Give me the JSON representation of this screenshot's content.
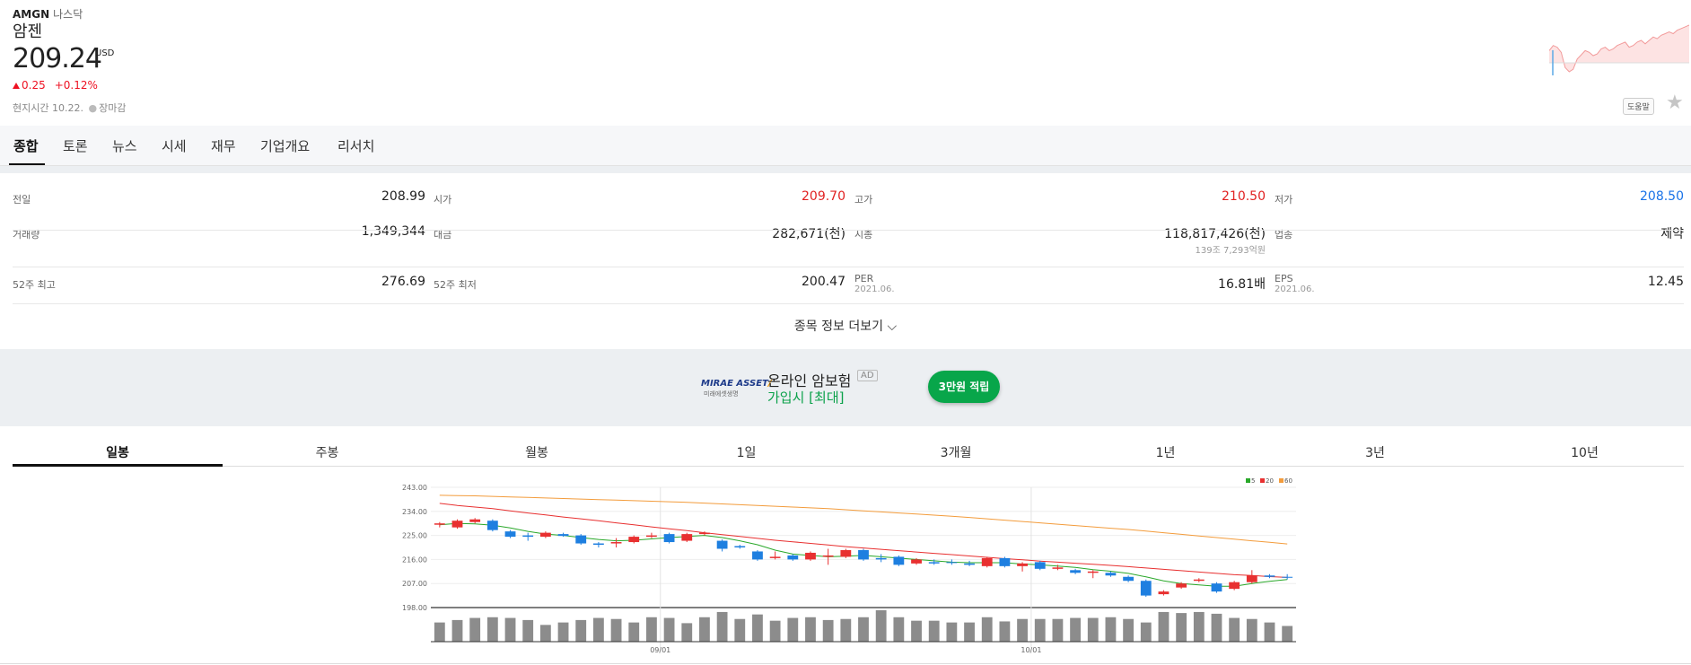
{
  "header": {
    "ticker": "AMGN",
    "market": "나스닥",
    "name": "암젠",
    "price": "209.24",
    "currency": "USD",
    "change": "0.25",
    "change_pct": "+0.12%",
    "local_time": "현지시간 10.22.",
    "market_status": "장마감",
    "help_label": "도움말",
    "star_icon": "star-icon",
    "up_color": "#e12222",
    "down_color": "#1a73e8"
  },
  "tabs": [
    "종합",
    "토론",
    "뉴스",
    "시세",
    "재무",
    "기업개요",
    "리서치"
  ],
  "stats": [
    {
      "label": "전일",
      "value": "208.99"
    },
    {
      "label": "시가",
      "value": "209.70",
      "color": "up"
    },
    {
      "label": "고가",
      "value": "210.50",
      "color": "up"
    },
    {
      "label": "저가",
      "value": "208.50",
      "color": "down"
    },
    {
      "label": "거래량",
      "value": "1,349,344"
    },
    {
      "label": "대금",
      "value": "282,671(천)"
    },
    {
      "label": "시총",
      "value": "118,817,426(천)",
      "sub_value": "139조 7,293억원"
    },
    {
      "label": "업종",
      "value": "제약"
    },
    {
      "label": "52주 최고",
      "value": "276.69"
    },
    {
      "label": "52주 최저",
      "value": "200.47"
    },
    {
      "label": "PER",
      "sub_label": "2021.06.",
      "value": "16.81배"
    },
    {
      "label": "EPS",
      "sub_label": "2021.06.",
      "value": "12.45"
    }
  ],
  "more_label": "종목 정보 더보기",
  "ad": {
    "logo": "MIRAE ASSET",
    "logo_sub": "미래에셋생명",
    "line1": "온라인 암보험",
    "badge": "AD",
    "line2": "가입시 [최대]",
    "button": "3만원 적립"
  },
  "periods": [
    "일봉",
    "주봉",
    "월봉",
    "1일",
    "3개월",
    "1년",
    "3년",
    "10년"
  ],
  "chart_data": {
    "type": "candlestick",
    "y_ticks": [
      "243.00",
      "234.00",
      "225.00",
      "216.00",
      "207.00",
      "198.00"
    ],
    "ylim": [
      198,
      243
    ],
    "x_ticks": [
      "09/01",
      "10/01"
    ],
    "legend": [
      "5",
      "20",
      "60"
    ],
    "legend_colors": [
      "#2aa82a",
      "#e83030",
      "#f39c3c"
    ],
    "candles": [
      {
        "o": 229,
        "c": 229.5,
        "h": 230,
        "l": 228
      },
      {
        "o": 228,
        "c": 230.5,
        "h": 231,
        "l": 227.5
      },
      {
        "o": 230,
        "c": 231,
        "h": 231.5,
        "l": 229.5
      },
      {
        "o": 230.5,
        "c": 227,
        "h": 231,
        "l": 226.5
      },
      {
        "o": 226.5,
        "c": 224.5,
        "h": 227,
        "l": 224
      },
      {
        "o": 225,
        "c": 224.5,
        "h": 226,
        "l": 223
      },
      {
        "o": 224.5,
        "c": 226,
        "h": 226.5,
        "l": 224
      },
      {
        "o": 225.5,
        "c": 224.8,
        "h": 226,
        "l": 224.5
      },
      {
        "o": 225,
        "c": 222,
        "h": 225.5,
        "l": 221.5
      },
      {
        "o": 222,
        "c": 221.5,
        "h": 222.5,
        "l": 220.5
      },
      {
        "o": 222,
        "c": 222.5,
        "h": 224,
        "l": 220.5
      },
      {
        "o": 222.5,
        "c": 224.5,
        "h": 225,
        "l": 222
      },
      {
        "o": 224.5,
        "c": 225,
        "h": 226,
        "l": 224
      },
      {
        "o": 225.5,
        "c": 222.5,
        "h": 226,
        "l": 222
      },
      {
        "o": 223,
        "c": 225.5,
        "h": 226,
        "l": 222.5
      },
      {
        "o": 225.5,
        "c": 226,
        "h": 226.5,
        "l": 225
      },
      {
        "o": 223,
        "c": 220,
        "h": 223.5,
        "l": 219
      },
      {
        "o": 221,
        "c": 220.5,
        "h": 221.5,
        "l": 220
      },
      {
        "o": 219,
        "c": 216,
        "h": 219.5,
        "l": 215.5
      },
      {
        "o": 216.5,
        "c": 217,
        "h": 219,
        "l": 216
      },
      {
        "o": 217.5,
        "c": 216,
        "h": 218,
        "l": 215.5
      },
      {
        "o": 216,
        "c": 218.5,
        "h": 219,
        "l": 215.5
      },
      {
        "o": 217,
        "c": 217.5,
        "h": 220,
        "l": 214
      },
      {
        "o": 217,
        "c": 219.5,
        "h": 220,
        "l": 216.5
      },
      {
        "o": 219.5,
        "c": 216,
        "h": 220,
        "l": 215.5
      },
      {
        "o": 216.5,
        "c": 216,
        "h": 218,
        "l": 215
      },
      {
        "o": 217,
        "c": 214,
        "h": 217.5,
        "l": 213.5
      },
      {
        "o": 214.5,
        "c": 216,
        "h": 216.5,
        "l": 214
      },
      {
        "o": 215,
        "c": 214.5,
        "h": 216,
        "l": 214
      },
      {
        "o": 215,
        "c": 214.8,
        "h": 216,
        "l": 214
      },
      {
        "o": 214.5,
        "c": 214,
        "h": 215.5,
        "l": 213.5
      },
      {
        "o": 213.5,
        "c": 216.5,
        "h": 217,
        "l": 213
      },
      {
        "o": 216.5,
        "c": 213.5,
        "h": 217,
        "l": 213
      },
      {
        "o": 213.5,
        "c": 214.5,
        "h": 215,
        "l": 211.5
      },
      {
        "o": 215,
        "c": 212.5,
        "h": 215.5,
        "l": 212
      },
      {
        "o": 212.5,
        "c": 213,
        "h": 214,
        "l": 212
      },
      {
        "o": 212,
        "c": 211,
        "h": 212.5,
        "l": 210.5
      },
      {
        "o": 211,
        "c": 211.5,
        "h": 212,
        "l": 209
      },
      {
        "o": 211,
        "c": 210,
        "h": 211.5,
        "l": 209.5
      },
      {
        "o": 209.5,
        "c": 208,
        "h": 210,
        "l": 207.5
      },
      {
        "o": 208,
        "c": 202.5,
        "h": 208.5,
        "l": 202
      },
      {
        "o": 203,
        "c": 204,
        "h": 204.5,
        "l": 202.5
      },
      {
        "o": 205.5,
        "c": 207,
        "h": 207.5,
        "l": 205
      },
      {
        "o": 208,
        "c": 208.5,
        "h": 209,
        "l": 207.5
      },
      {
        "o": 207,
        "c": 204,
        "h": 207.5,
        "l": 203.5
      },
      {
        "o": 205,
        "c": 207.5,
        "h": 208,
        "l": 204.5
      },
      {
        "o": 207.5,
        "c": 210,
        "h": 212,
        "l": 207
      },
      {
        "o": 210,
        "c": 209.5,
        "h": 210.5,
        "l": 209
      },
      {
        "o": 209.5,
        "c": 209.24,
        "h": 210.5,
        "l": 208.5
      }
    ],
    "ma5": [
      229,
      229.5,
      229.3,
      228.8,
      227.8,
      226.5,
      225.5,
      225,
      224.2,
      223.5,
      223,
      223.2,
      223.7,
      224.2,
      224.6,
      225,
      224.2,
      223,
      221.5,
      219.5,
      218,
      217.5,
      217,
      217.2,
      217.5,
      217,
      216.5,
      216,
      215.5,
      215,
      214.8,
      214.8,
      214.8,
      214.3,
      214,
      213.5,
      213,
      212.2,
      211.6,
      210.8,
      209.5,
      208,
      207,
      206.5,
      206,
      206,
      207,
      207.8,
      208.5
    ],
    "ma20": [
      237,
      236.2,
      235.6,
      235,
      234.2,
      233.4,
      232.7,
      231.9,
      231.2,
      230.5,
      229.7,
      229,
      228.2,
      227.5,
      226.8,
      226,
      225.3,
      224.6,
      223.9,
      223.2,
      222.6,
      222,
      221.4,
      220.8,
      220.3,
      219.8,
      219.3,
      218.8,
      218.3,
      217.8,
      217.3,
      216.8,
      216.3,
      215.9,
      215.4,
      215,
      214.6,
      214.2,
      213.8,
      213.3,
      212.8,
      212.3,
      211.8,
      211.3,
      210.8,
      210.3,
      210,
      209.6,
      209.3
    ],
    "ma60": [
      240,
      239.9,
      239.8,
      239.6,
      239.4,
      239.2,
      239,
      238.8,
      238.6,
      238.4,
      238.2,
      238,
      237.8,
      237.6,
      237.4,
      237.1,
      236.8,
      236.5,
      236.2,
      235.9,
      235.6,
      235.3,
      235,
      234.6,
      234.2,
      233.8,
      233.4,
      233,
      232.6,
      232.2,
      231.7,
      231.2,
      230.7,
      230.2,
      229.7,
      229.2,
      228.7,
      228.2,
      227.7,
      227.2,
      226.6,
      226,
      225.4,
      224.8,
      224.2,
      223.6,
      223,
      222.4,
      221.8
    ],
    "volume": [
      55,
      62,
      68,
      70,
      68,
      62,
      48,
      55,
      62,
      68,
      65,
      55,
      70,
      68,
      53,
      70,
      85,
      65,
      78,
      60,
      68,
      70,
      62,
      65,
      70,
      90,
      70,
      60,
      60,
      55,
      55,
      70,
      58,
      65,
      65,
      65,
      68,
      68,
      70,
      65,
      55,
      85,
      82,
      85,
      80,
      68,
      65,
      55,
      45
    ]
  },
  "sparkline": [
    60,
    66,
    64,
    58,
    40,
    35,
    38,
    50,
    55,
    60,
    58,
    54,
    56,
    62,
    64,
    60,
    62,
    66,
    68,
    70,
    64,
    66,
    70,
    72,
    68,
    72,
    76,
    74,
    78,
    80,
    82,
    80,
    84,
    86,
    88,
    90
  ]
}
